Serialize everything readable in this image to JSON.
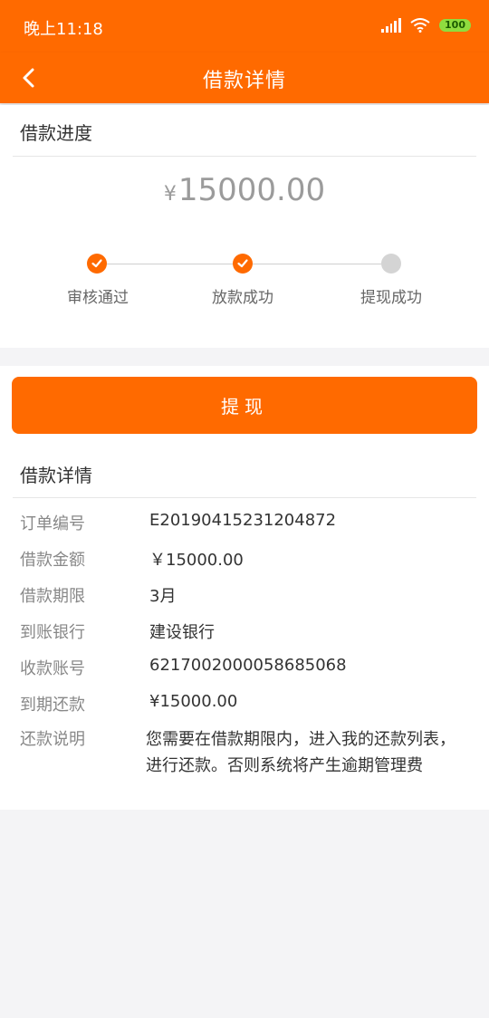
{
  "status_bar": {
    "time": "晚上11:18",
    "battery": "100"
  },
  "nav": {
    "title": "借款详情"
  },
  "progress": {
    "section_title": "借款进度",
    "currency_symbol": "¥",
    "amount": "15000.00",
    "steps": [
      {
        "label": "审核通过",
        "done": true
      },
      {
        "label": "放款成功",
        "done": true
      },
      {
        "label": "提现成功",
        "done": false
      }
    ]
  },
  "action": {
    "withdraw_label": "提现"
  },
  "details": {
    "section_title": "借款详情",
    "rows": [
      {
        "label": "订单编号",
        "value": "E20190415231204872"
      },
      {
        "label": "借款金额",
        "value": "￥15000.00"
      },
      {
        "label": "借款期限",
        "value": "3月"
      },
      {
        "label": "到账银行",
        "value": "建设银行"
      },
      {
        "label": "收款账号",
        "value": "6217002000058685068"
      },
      {
        "label": "到期还款",
        "value": "¥15000.00"
      },
      {
        "label": "还款说明",
        "value": "您需要在借款期限内，进入我的还款列表，进行还款。否则系统将产生逾期管理费"
      }
    ]
  },
  "colors": {
    "accent": "#ff6a00",
    "pending": "#d4d4d4",
    "background": "#f4f4f6"
  }
}
